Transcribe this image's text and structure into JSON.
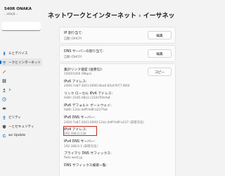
{
  "user": {
    "name": "540R ONAKA",
    "email": "...okajd..."
  },
  "sidebar": {
    "items": [
      {
        "label": "ルとデバイス",
        "icon": "bluetooth-icon"
      },
      {
        "label": "ークとインターネット",
        "icon": "network-icon"
      },
      {
        "label": "",
        "icon": "personalize-icon"
      },
      {
        "label": "",
        "icon": "apps-icon"
      },
      {
        "label": "ト",
        "icon": "accounts-icon"
      },
      {
        "label": "",
        "icon": "time-icon"
      },
      {
        "label": "",
        "icon": "gaming-icon"
      },
      {
        "label": "ビリティ",
        "icon": "accessibility-icon"
      },
      {
        "label": "ーとセキュリティ",
        "icon": "shield-icon"
      },
      {
        "label": "ws Update",
        "icon": "update-icon"
      }
    ],
    "active_index": 1,
    "active_color": "#0067c0"
  },
  "header": {
    "crumb_parent": "ネットワークとインターネット",
    "separator": "›",
    "crumb_current": "イーサネット"
  },
  "ip_card": {
    "label": "IP 割り当て:",
    "value": "自動 (DHCP)",
    "edit": "編集"
  },
  "dns_card": {
    "label": "DNS サーバーの割り当て:",
    "value": "自動 (DHCP)",
    "edit": "編集"
  },
  "details": {
    "copy": "コピー",
    "items": [
      {
        "label": "集計リンク速度 (送受信):",
        "value": "1000/1000 (Mbps)"
      },
      {
        "label": "IPv6 アドレス:",
        "value": "2404:7a87:3041:0000:0ba0:85af:f077:f660"
      },
      {
        "label": "リンク ローカル IPv6 アドレス:",
        "value": "fe80::2185:d8a1:c218:f59a%8"
      },
      {
        "label": "IPv6 デフォルト ゲートウェイ:",
        "value": "fe80::12dc:4dff:fe8f:a237%8"
      },
      {
        "label": "IPv6 DNS サーバー:",
        "value": "2404:7a87:3041:0000:12dc:4dff:fe8f:a237 (非暗号化)"
      },
      {
        "label": "IPv4 アドレス:",
        "value": "192.168.0.130"
      },
      {
        "label": "IPv4 DNS サーバー:",
        "value": "192.168.0.1 (非暗号化)"
      },
      {
        "label": "プライマリ DNS サフィックス:",
        "value": "flets-west.jp"
      },
      {
        "label": "DNS サフィックス検索一覧:",
        "value": ""
      }
    ],
    "highlight_color": "#c42b1c"
  }
}
